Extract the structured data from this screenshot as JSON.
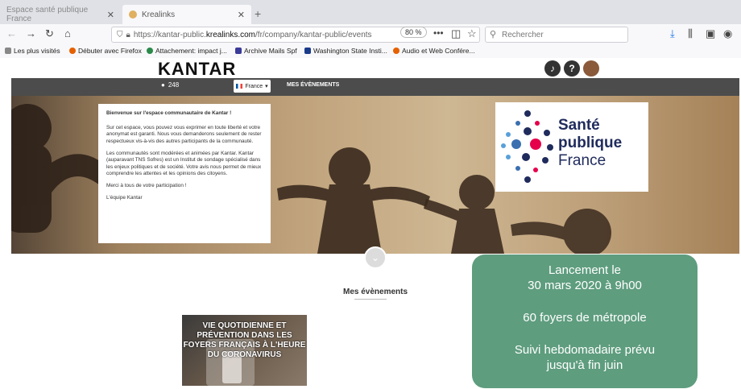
{
  "browser": {
    "tabs": [
      {
        "label": "Espace santé publique France"
      },
      {
        "label": "Krealinks"
      }
    ],
    "url_prefix": "https://kantar-public.",
    "url_domain": "krealinks.com",
    "url_path": "/fr/company/kantar-public/events",
    "zoom": "80 %",
    "search_placeholder": "Rechercher",
    "bookmarks": [
      {
        "label": "Les plus visités",
        "color": "#888888"
      },
      {
        "label": "Débuter avec Firefox",
        "color": "#e66000"
      },
      {
        "label": "Attachement: impact j...",
        "color": "#2a8a4a"
      },
      {
        "label": "Archive Mails Spf",
        "color": "#3a3a9a"
      },
      {
        "label": "Washington State Insti...",
        "color": "#1a3a8a"
      },
      {
        "label": "Audio et Web Confére...",
        "color": "#e66000"
      }
    ]
  },
  "kantar": {
    "logo": "KANTAR",
    "help_icon": "?",
    "user_count": "248",
    "language": "France",
    "events_nav": "MES ÉVÈNEMENTS"
  },
  "welcome": {
    "title": "Bienvenue sur l'espace communautaire de Kantar !",
    "p1": "Sur cet espace, vous pouvez vous exprimer en toute liberté et votre anonymat est garanti. Nous vous demanderons seulement de rester respectueux vis-à-vis des autres participants de la communauté.",
    "p2": "Les communautés sont modérées et animées par Kantar. Kantar (auparavant TNS Sofres) est un Institut de sondage spécialisé dans les enjeux politiques et de société. Votre avis nous permet de mieux comprendre les attentes et les opinions des citoyens.",
    "p3": "Merci à tous de votre participation !",
    "sign": "L'équipe Kantar"
  },
  "sante_logo": {
    "line1": "Santé",
    "line2": "publique",
    "line3": "France"
  },
  "section_title": "Mes évènements",
  "event_card": {
    "title": "VIE QUOTIDIENNE ET PRÉVENTION DANS LES FOYERS FRANÇAIS À L'HEURE DU CORONAVIRUS"
  },
  "callout": {
    "line1": "Lancement le",
    "line2": "30 mars 2020 à 9h00",
    "line3": "60 foyers de métropole",
    "line4": "Suivi hebdomadaire prévu",
    "line5": "jusqu'à fin juin",
    "color": "#5e9d7e"
  }
}
